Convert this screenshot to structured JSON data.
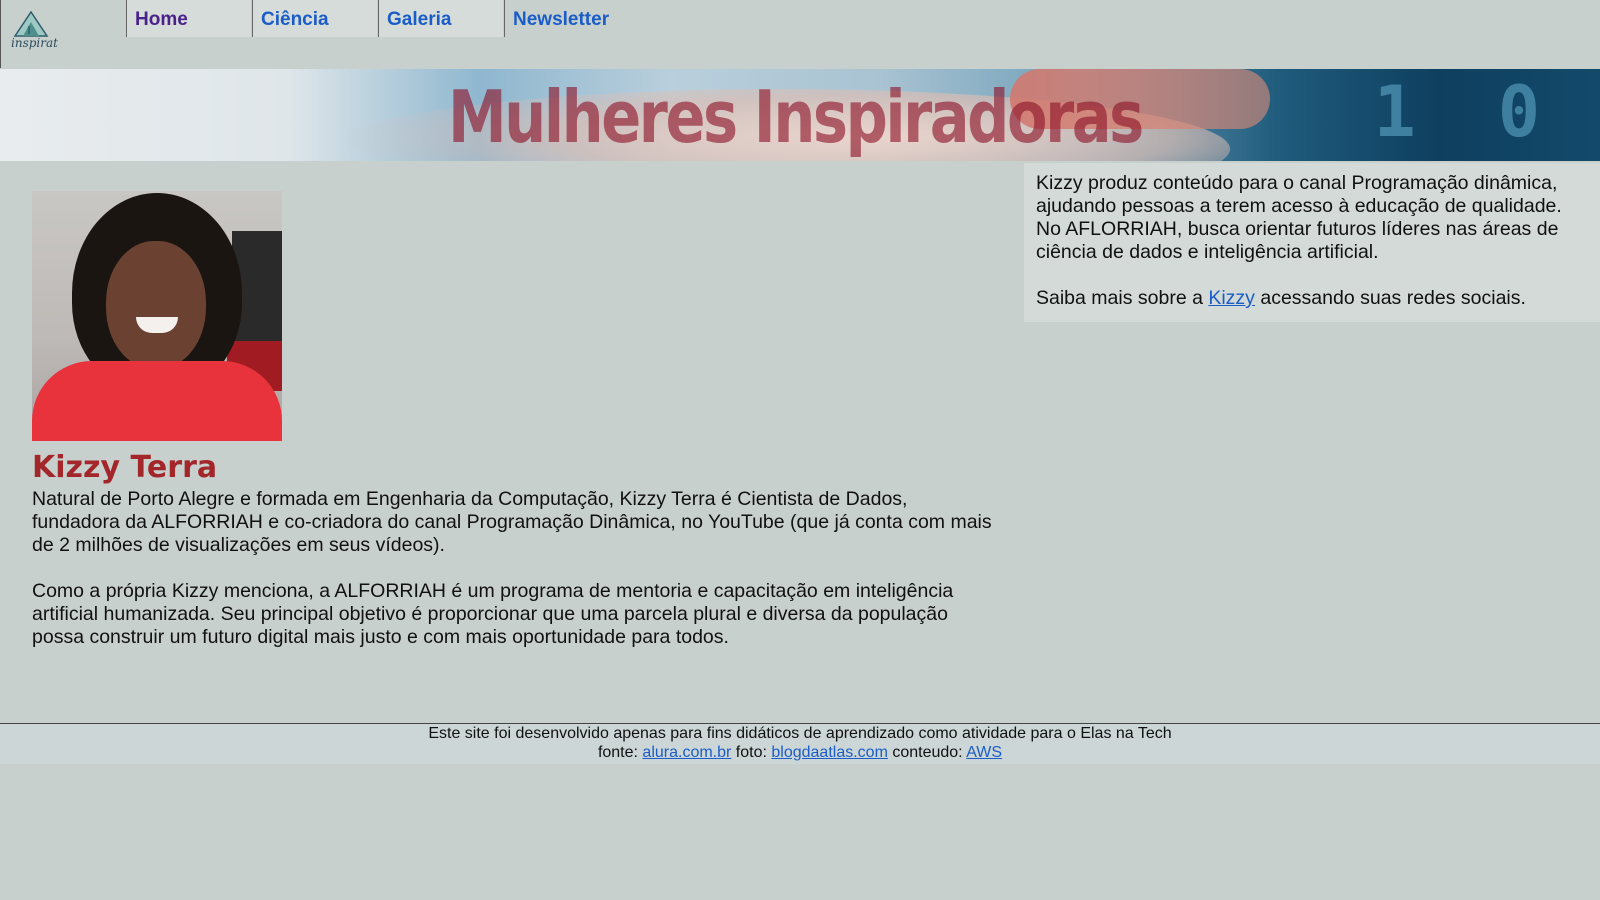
{
  "nav": {
    "logo_text": "inspirat",
    "items": [
      "Home",
      "Ciência",
      "Galeria",
      "Newsletter"
    ]
  },
  "banner": {
    "title": "Mulheres Inspiradoras",
    "digits": "1 0"
  },
  "profile": {
    "name": "Kizzy Terra",
    "paragraph1": "Natural de Porto Alegre e formada em Engenharia da Computação, Kizzy Terra é Cientista de Dados, fundadora da ALFORRIAH e co-criadora do canal Programação Dinâmica, no YouTube (que já conta com mais de 2 milhões de visualizações em seus vídeos).",
    "paragraph2": "Como a própria Kizzy menciona, a ALFORRIAH é um programa de mentoria e capacitação em inteligência artificial humanizada. Seu principal objetivo é proporcionar que uma parcela plural e diversa da população possa construir um futuro digital mais justo e com mais oportunidade para todos."
  },
  "aside": {
    "text": "Kizzy produz conteúdo para o canal Programação dinâmica, ajudando pessoas a terem acesso à educação de qualidade. No AFLORRIAH, busca orientar futuros líderes nas áreas de ciência de dados e inteligência artificial.",
    "more_prefix": "Saiba mais sobre a ",
    "more_link": "Kizzy",
    "more_suffix": " acessando suas redes sociais."
  },
  "footer": {
    "line1": "Este site foi desenvolvido apenas para fins didáticos de aprendizado como atividade para o Elas na Tech",
    "fonte_label": "fonte: ",
    "fonte_link": "alura.com.br",
    "foto_label": " foto: ",
    "foto_link": "blogdaatlas.com",
    "conteudo_label": " conteudo: ",
    "conteudo_link": "AWS"
  },
  "colors": {
    "background": "#c8d0cd",
    "nav_active": "#4a2289",
    "link": "#1a5dc8",
    "name": "#a3262a"
  }
}
